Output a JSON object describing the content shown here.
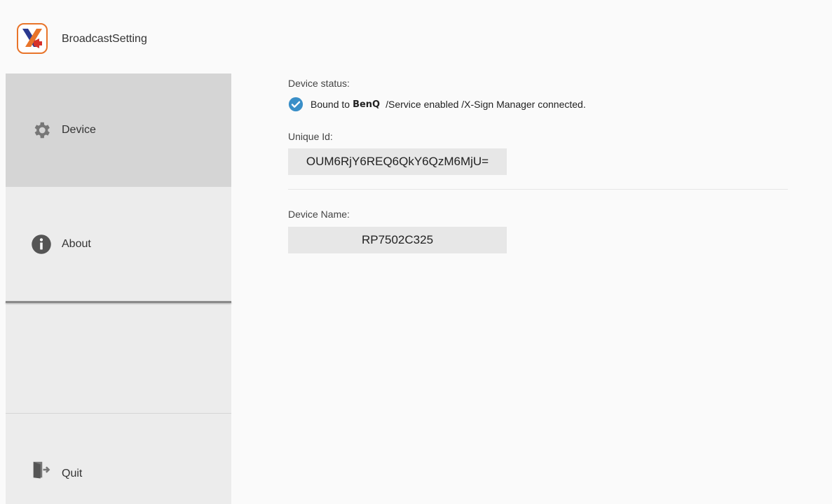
{
  "app": {
    "title": "BroadcastSetting",
    "icon": "x-sign-broadcast-icon",
    "accent_color": "#e8742a"
  },
  "sidebar": {
    "items": [
      {
        "label": "Device",
        "icon": "gear-icon",
        "selected": true
      },
      {
        "label": "About",
        "icon": "info-icon",
        "selected": false
      },
      {
        "label": "Quit",
        "icon": "exit-icon",
        "selected": false
      }
    ]
  },
  "device": {
    "status_label": "Device status:",
    "status_prefix": "Bound to",
    "status_brand": "BenQ",
    "status_suffix": "/Service enabled /X-Sign Manager connected.",
    "status_icon": "check-circle-icon",
    "status_color": "#3a8fc8",
    "unique_id_label": "Unique Id:",
    "unique_id": "OUM6RjY6REQ6QkY6QzM6MjU=",
    "device_name_label": "Device Name:",
    "device_name": "RP7502C325"
  }
}
